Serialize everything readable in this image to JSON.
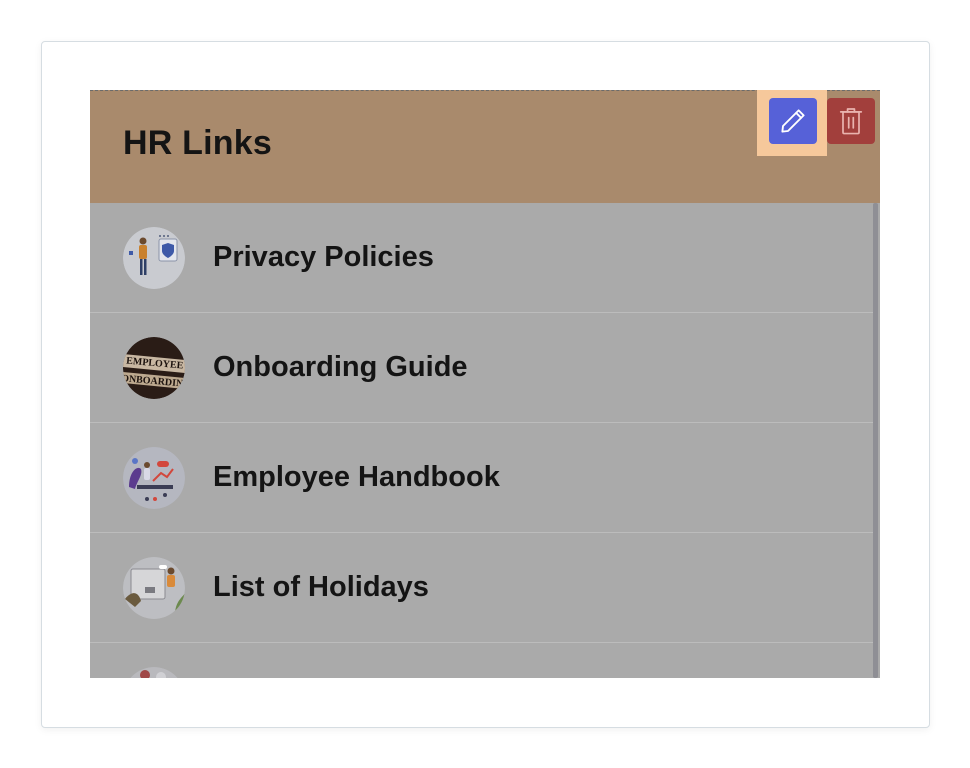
{
  "widget": {
    "title": "HR Links",
    "edit_label": "Edit",
    "delete_label": "Delete"
  },
  "links": [
    {
      "label": "Privacy Policies",
      "icon": "privacy-thumbnail"
    },
    {
      "label": "Onboarding Guide",
      "icon": "onboarding-thumbnail",
      "thumb_text_1": "EMPLOYEE",
      "thumb_text_2": "ONBOARDING"
    },
    {
      "label": "Employee Handbook",
      "icon": "handbook-thumbnail"
    },
    {
      "label": "List of Holidays",
      "icon": "holidays-thumbnail"
    },
    {
      "label": "",
      "icon": "partial-thumbnail"
    }
  ],
  "colors": {
    "header": "#a98a6c",
    "edit_button": "#5661d8",
    "delete_button": "#a23f3c",
    "highlight": "#f6c89b",
    "list_overlay": "#aaaaaa"
  }
}
